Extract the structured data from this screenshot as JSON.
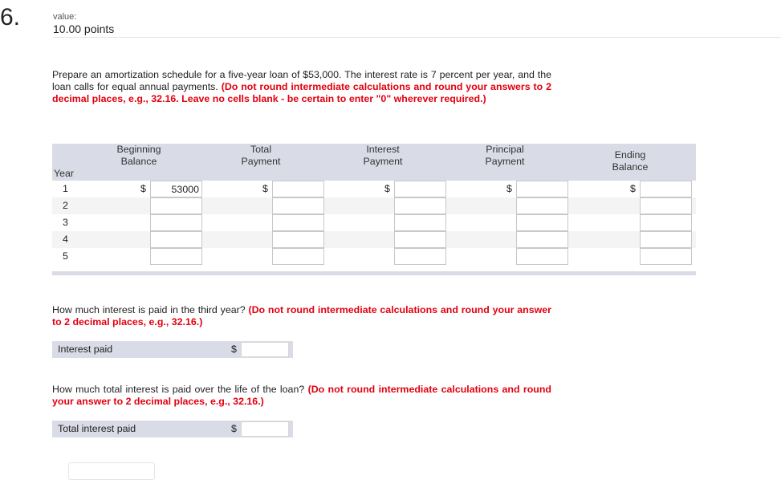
{
  "question": {
    "number": "6.",
    "value_label": "value:",
    "points": "10.00 points"
  },
  "prompt": {
    "text": "Prepare an amortization schedule for a five-year loan of $53,000. The interest rate is 7 percent per year, and the loan calls for equal annual payments. ",
    "instruction": "(Do not round intermediate calculations and round your answers to 2 decimal places, e.g., 32.16. Leave no cells blank - be certain to enter \"0\" wherever required.)"
  },
  "table": {
    "year_header": "Year",
    "columns": [
      {
        "line1": "Beginning",
        "line2": "Balance"
      },
      {
        "line1": "Total",
        "line2": "Payment"
      },
      {
        "line1": "Interest",
        "line2": "Payment"
      },
      {
        "line1": "Principal",
        "line2": "Payment"
      },
      {
        "line1": "Ending",
        "line2": "Balance"
      }
    ],
    "currency_symbol": "$",
    "rows": [
      {
        "year": "1",
        "values": [
          "53000",
          "",
          "",
          "",
          ""
        ]
      },
      {
        "year": "2",
        "values": [
          "",
          "",
          "",
          "",
          ""
        ]
      },
      {
        "year": "3",
        "values": [
          "",
          "",
          "",
          "",
          ""
        ]
      },
      {
        "year": "4",
        "values": [
          "",
          "",
          "",
          "",
          ""
        ]
      },
      {
        "year": "5",
        "values": [
          "",
          "",
          "",
          "",
          ""
        ]
      }
    ]
  },
  "q2": {
    "text": "How much interest is paid in the third year? ",
    "instruction": "(Do not round intermediate calculations and round your answer to 2 decimal places, e.g., 32.16.)",
    "label": "Interest paid",
    "currency_symbol": "$",
    "value": ""
  },
  "q3": {
    "text": "How much total interest is paid over the life of the loan? ",
    "instruction": "(Do not round intermediate calculations and round your answer to 2 decimal places, e.g., 32.16.)",
    "label": "Total interest paid",
    "currency_symbol": "$",
    "value": ""
  },
  "colors": {
    "instruction_red": "#e3000f",
    "header_band": "#d9dce6",
    "alt_row": "#f4f4f4"
  }
}
